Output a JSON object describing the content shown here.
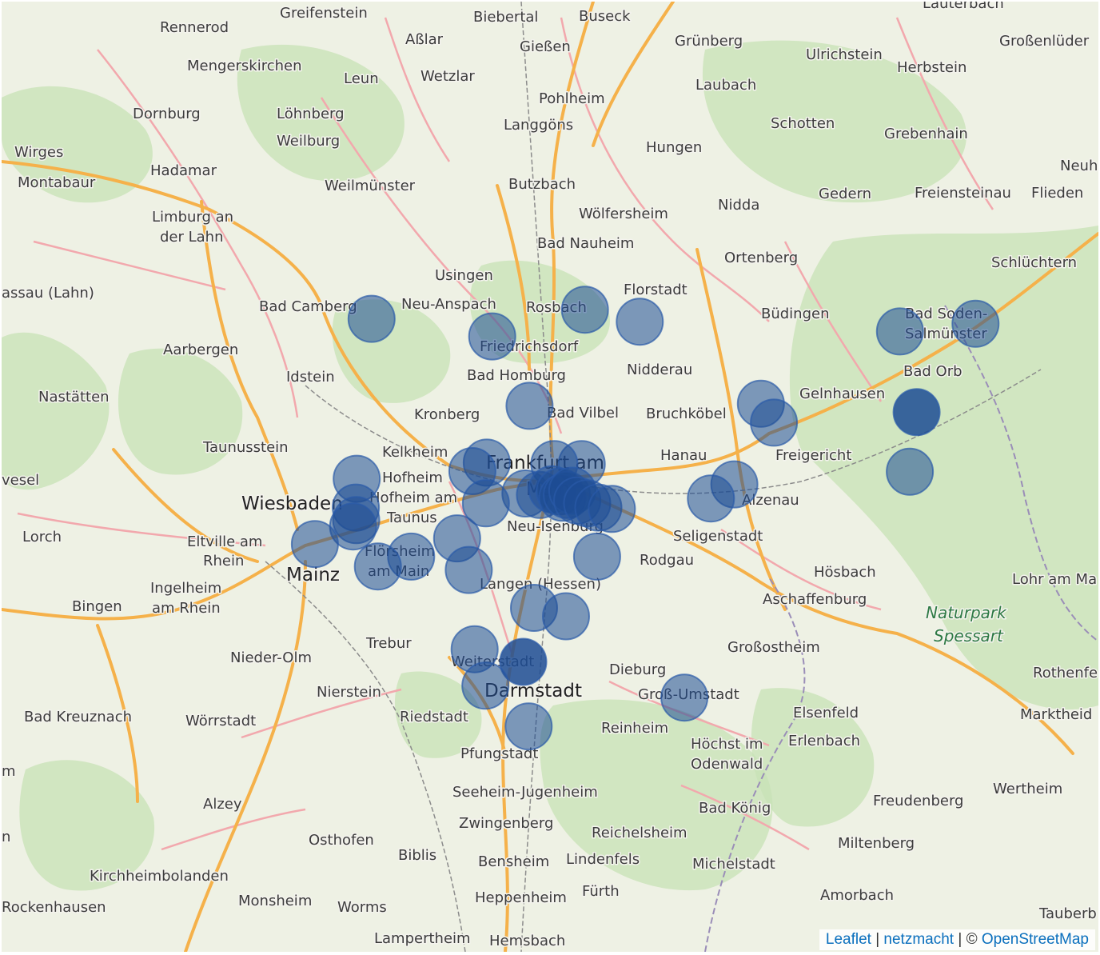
{
  "map": {
    "colors": {
      "land": "#eef1e4",
      "forest": "#c7e2b6",
      "motorway": "#f5b14a",
      "primary": "#f2a8ad",
      "rail": "#8c8c8c",
      "marker": "#1d4c94",
      "border": "#9a8db8"
    },
    "places": [
      "Greifenstein",
      "Biebertal",
      "Buseck",
      "Lauterbach",
      "Rennerod",
      "Aßlar",
      "Gießen",
      "Grünberg",
      "Großenlüder",
      "Mengerskirchen",
      "Leun",
      "Wetzlar",
      "Ulrichstein",
      "Herbstein",
      "Laubach",
      "Dornburg",
      "Löhnberg",
      "Pohlheim",
      "Langgöns",
      "Schotten",
      "Grebenhain",
      "Weilburg",
      "Hungen",
      "Wirges",
      "Hadamar",
      "Neuh",
      "Montabaur",
      "Weilmünster",
      "Butzbach",
      "Gedern",
      "Freiensteinau",
      "Flieden",
      "Nidda",
      "Limburg an",
      "der Lahn",
      "Wölfersheim",
      "Bad Nauheim",
      "Ortenberg",
      "Schlüchtern",
      "assau (Lahn)",
      "Usingen",
      "Florstadt",
      "Bad Camberg",
      "Neu-Anspach",
      "Rosbach",
      "Büdingen",
      "Bad Soden-",
      "Salmünster",
      "Aarbergen",
      "Friedrichsdorf",
      "Nidderau",
      "Bad Orb",
      "Idstein",
      "Bad Homburg",
      "Gelnhausen",
      "Nastätten",
      "Kronberg",
      "Bad Vilbel",
      "Bruchköbel",
      "Taunusstein",
      "Kelkheim",
      "Frankfurt am",
      "Main",
      "Hanau",
      "Freigericht",
      "Hofheim",
      "Hofheim am",
      "Taunus",
      "vesel",
      "Wiesbaden",
      "Alzenau",
      "Neu-Isenburg",
      "Seligenstadt",
      "Lorch",
      "Eltville am",
      "Rhein",
      "Flörsheim",
      "Rodgau",
      "Hösbach",
      "Lohr am Ma",
      "am Main",
      "Mainz",
      "Ingelheim",
      "Langen (Hessen)",
      "Bingen",
      "am Rhein",
      "Aschaffenburg",
      "Naturpark",
      "Spessart",
      "Trebur",
      "Großostheim",
      "Nieder-Olm",
      "Weiterstadt",
      "Dieburg",
      "Rothenfe",
      "Darmstadt",
      "Nierstein",
      "Groß-Umstadt",
      "Marktheid",
      "Bad Kreuznach",
      "Wörrstadt",
      "Riedstadt",
      "Reinheim",
      "Elsenfeld",
      "Höchst im",
      "Odenwald",
      "Erlenbach",
      "Pfungstadt",
      "Seeheim-Jugenheim",
      "Alzey",
      "Freudenberg",
      "Wertheim",
      "Bad König",
      "Zwingenberg",
      "Osthofen",
      "Reichelsheim",
      "Miltenberg",
      "Biblis",
      "Bensheim",
      "Lindenfels",
      "Michelstadt",
      "Kirchheimbolanden",
      "Amorbach",
      "Fürth",
      "Rockenhausen",
      "Monsheim",
      "Worms",
      "Heppenheim",
      "Tauberb",
      "Lampertheim",
      "Hemsbach",
      "m",
      "n"
    ],
    "markers": [
      {
        "lat": 50.351,
        "lon": 8.266,
        "op": 0.55
      },
      {
        "lat": 50.364,
        "lon": 8.74,
        "op": 0.55
      },
      {
        "lat": 50.347,
        "lon": 8.862,
        "op": 0.55
      },
      {
        "lat": 50.326,
        "lon": 8.534,
        "op": 0.55
      },
      {
        "lat": 50.333,
        "lon": 9.44,
        "op": 0.55
      },
      {
        "lat": 50.344,
        "lon": 9.608,
        "op": 0.55
      },
      {
        "lat": 50.23,
        "lon": 9.131,
        "op": 0.55
      },
      {
        "lat": 50.218,
        "lon": 9.477,
        "op": 0.85
      },
      {
        "lat": 50.203,
        "lon": 9.16,
        "op": 0.55
      },
      {
        "lat": 50.227,
        "lon": 8.617,
        "op": 0.55
      },
      {
        "lat": 50.133,
        "lon": 9.462,
        "op": 0.55
      },
      {
        "lat": 50.123,
        "lon": 8.233,
        "op": 0.55
      },
      {
        "lat": 50.144,
        "lon": 8.733,
        "op": 0.55
      },
      {
        "lat": 50.146,
        "lon": 8.522,
        "op": 0.55
      },
      {
        "lat": 50.134,
        "lon": 8.49,
        "op": 0.55
      },
      {
        "lat": 50.144,
        "lon": 8.672,
        "op": 0.55
      },
      {
        "lat": 50.115,
        "lon": 9.072,
        "op": 0.55
      },
      {
        "lat": 50.095,
        "lon": 9.02,
        "op": 0.55
      },
      {
        "lat": 50.102,
        "lon": 8.608,
        "op": 0.55
      },
      {
        "lat": 50.1,
        "lon": 8.64,
        "op": 0.55
      },
      {
        "lat": 50.108,
        "lon": 8.667,
        "op": 0.55
      },
      {
        "lat": 50.105,
        "lon": 8.684,
        "op": 0.55
      },
      {
        "lat": 50.096,
        "lon": 8.69,
        "op": 0.55
      },
      {
        "lat": 50.1,
        "lon": 8.7,
        "op": 0.55
      },
      {
        "lat": 50.106,
        "lon": 8.712,
        "op": 0.55
      },
      {
        "lat": 50.092,
        "lon": 8.723,
        "op": 0.55
      },
      {
        "lat": 50.088,
        "lon": 8.745,
        "op": 0.55
      },
      {
        "lat": 50.082,
        "lon": 8.77,
        "op": 0.55
      },
      {
        "lat": 50.08,
        "lon": 8.8,
        "op": 0.55
      },
      {
        "lat": 50.088,
        "lon": 8.52,
        "op": 0.55
      },
      {
        "lat": 50.082,
        "lon": 8.231,
        "op": 0.55
      },
      {
        "lat": 50.064,
        "lon": 8.232,
        "op": 0.55
      },
      {
        "lat": 50.055,
        "lon": 8.225,
        "op": 0.55
      },
      {
        "lat": 50.03,
        "lon": 8.14,
        "op": 0.55
      },
      {
        "lat": 50.038,
        "lon": 8.456,
        "op": 0.55
      },
      {
        "lat": 50.012,
        "lon": 8.354,
        "op": 0.55
      },
      {
        "lat": 49.998,
        "lon": 8.28,
        "op": 0.55
      },
      {
        "lat": 49.993,
        "lon": 8.482,
        "op": 0.55
      },
      {
        "lat": 50.012,
        "lon": 8.767,
        "op": 0.55
      },
      {
        "lat": 49.939,
        "lon": 8.627,
        "op": 0.55
      },
      {
        "lat": 49.927,
        "lon": 8.698,
        "op": 0.55
      },
      {
        "lat": 49.88,
        "lon": 8.495,
        "op": 0.55
      },
      {
        "lat": 49.862,
        "lon": 8.603,
        "op": 0.85
      },
      {
        "lat": 49.828,
        "lon": 8.519,
        "op": 0.55
      },
      {
        "lat": 49.811,
        "lon": 8.961,
        "op": 0.55
      },
      {
        "lat": 49.77,
        "lon": 8.615,
        "op": 0.55
      }
    ],
    "attribution": {
      "leaflet": "Leaflet",
      "sep1": "|",
      "netzmacht": "netzmacht",
      "sep2": "| ©",
      "osm": "OpenStreetMap"
    }
  }
}
